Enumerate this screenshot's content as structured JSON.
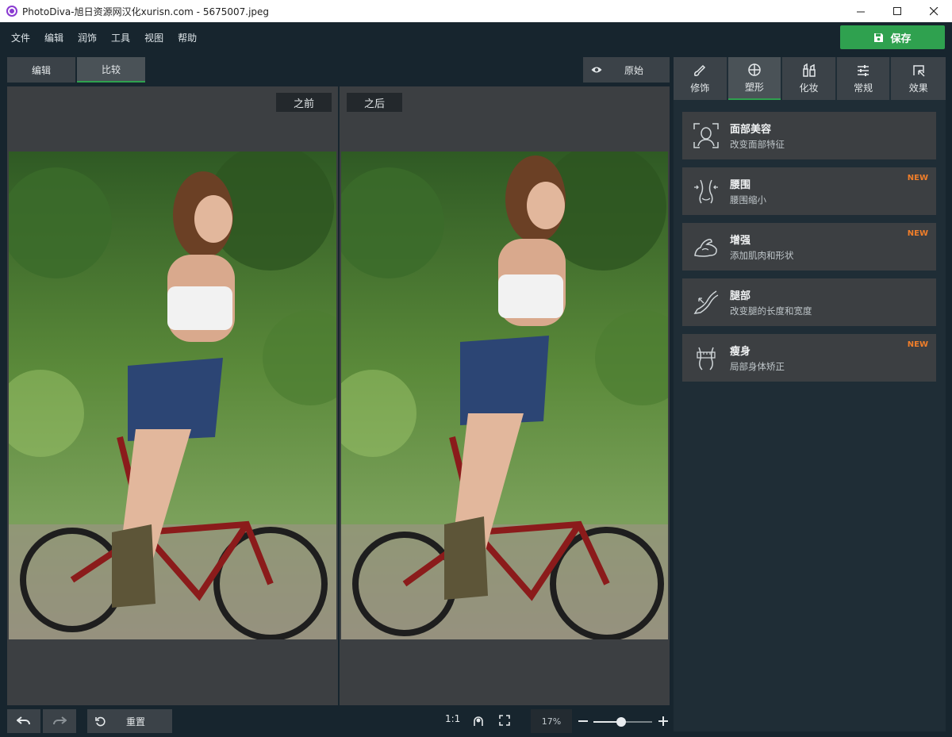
{
  "window": {
    "title": "PhotoDiva-旭日资源网汉化xurisn.com - 5675007.jpeg",
    "controls": [
      "minimize",
      "maximize",
      "close"
    ]
  },
  "menu": {
    "items": [
      "文件",
      "编辑",
      "润饰",
      "工具",
      "视图",
      "帮助"
    ],
    "save_label": "保存"
  },
  "view_tabs": [
    {
      "label": "编辑",
      "active": false
    },
    {
      "label": "比较",
      "active": true
    }
  ],
  "original_button": "原始",
  "compare": {
    "before_label": "之前",
    "after_label": "之后"
  },
  "bottom": {
    "reset_label": "重置",
    "ratio_label": "1:1",
    "zoom_value": "17%",
    "zoom_level": 0.47
  },
  "right_tabs": [
    {
      "label": "修饰",
      "icon": "brush-icon",
      "active": false
    },
    {
      "label": "塑形",
      "icon": "reshape-icon",
      "active": true
    },
    {
      "label": "化妆",
      "icon": "makeup-icon",
      "active": false
    },
    {
      "label": "常规",
      "icon": "sliders-icon",
      "active": false
    },
    {
      "label": "效果",
      "icon": "effects-icon",
      "active": false
    }
  ],
  "features": [
    {
      "title": "面部美容",
      "subtitle": "改变面部特征",
      "new": false,
      "icon": "face-icon"
    },
    {
      "title": "腰围",
      "subtitle": "腰围缩小",
      "new": true,
      "icon": "waist-icon"
    },
    {
      "title": "增强",
      "subtitle": "添加肌肉和形状",
      "new": true,
      "icon": "muscle-icon"
    },
    {
      "title": "腿部",
      "subtitle": "改变腿的长度和宽度",
      "new": false,
      "icon": "leg-icon"
    },
    {
      "title": "瘦身",
      "subtitle": "局部身体矫正",
      "new": true,
      "icon": "slim-icon"
    }
  ],
  "new_badge": "NEW",
  "colors": {
    "accent_green": "#2fa14f",
    "new_orange": "#f07e2a",
    "background": "#17252e"
  }
}
